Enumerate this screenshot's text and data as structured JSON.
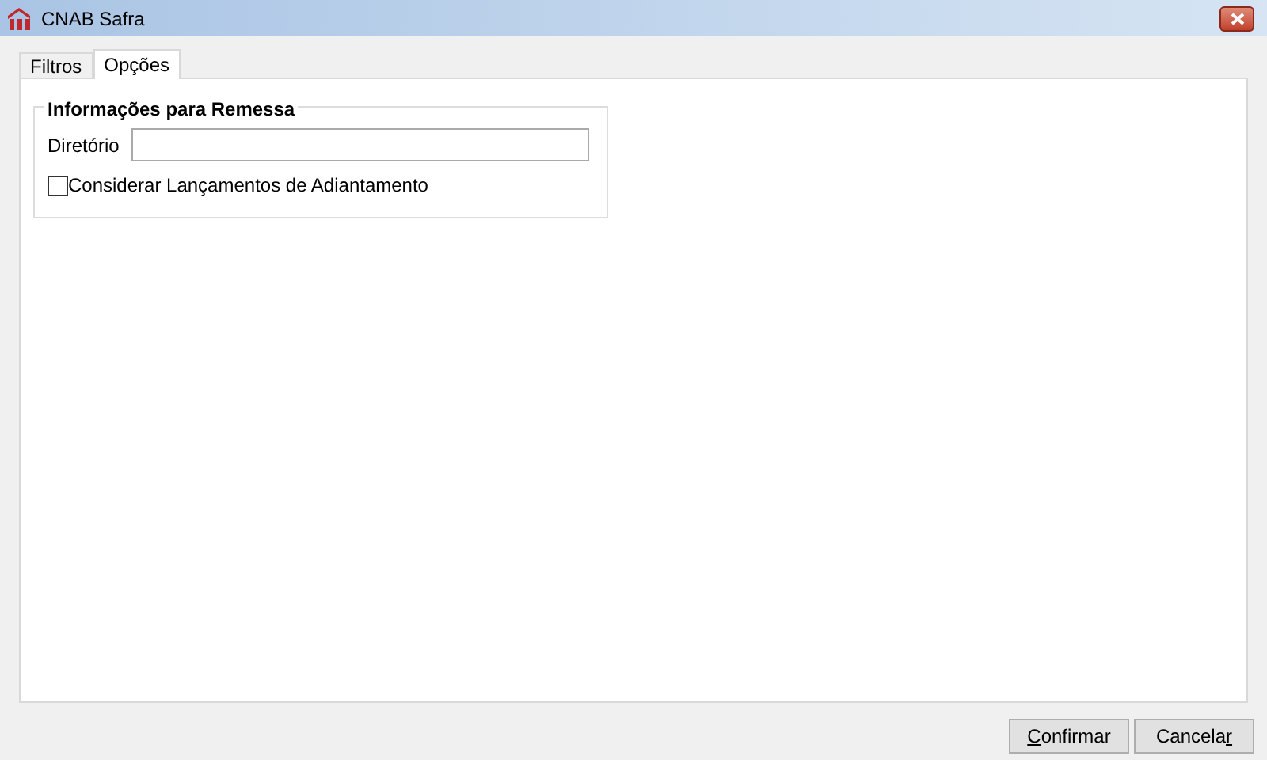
{
  "window": {
    "title": "CNAB Safra"
  },
  "tabs": [
    {
      "label": "Filtros",
      "selected": false
    },
    {
      "label": "Opções",
      "selected": true
    }
  ],
  "group": {
    "title": "Informações para Remessa",
    "directory": {
      "label": "Diretório"
    },
    "checkbox": {
      "label": "Considerar Lançamentos de Adiantamento",
      "checked": false
    }
  },
  "buttons": [
    {
      "label_parts": [
        {
          "text": "C",
          "underlined": true
        },
        {
          "text": "onfirmar",
          "underlined": false
        }
      ]
    },
    {
      "label_parts": [
        {
          "text": "Cancela",
          "underlined": false
        },
        {
          "text": "r",
          "underlined": true
        }
      ]
    }
  ]
}
